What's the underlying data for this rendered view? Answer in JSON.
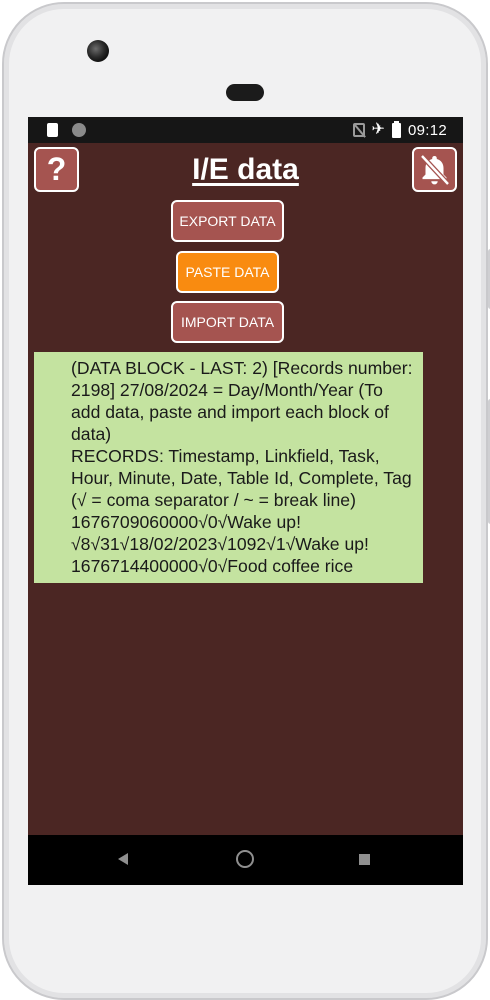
{
  "status_bar": {
    "time": "09:12",
    "icons": [
      "sd-card-icon",
      "sync-circle-icon",
      "no-sim-icon",
      "airplane-icon",
      "battery-icon"
    ]
  },
  "header": {
    "title": "I/E data",
    "help_label": "?",
    "help_icon": "question-mark-icon",
    "bell_icon": "bell-off-icon"
  },
  "actions": {
    "export_label": "EXPORT DATA",
    "paste_label": "PASTE DATA",
    "import_label": "IMPORT DATA"
  },
  "data_block": {
    "text": "(DATA BLOCK - LAST: 2) [Records number: 2198] 27/08/2024 = Day/Month/Year (To add data, paste and import each block of data)\nRECORDS: Timestamp, Linkfield, Task, Hour, Minute, Date, Table Id, Complete, Tag (√ = coma separator / ~ = break line)\n1676709060000√0√Wake up!√8√31√18/02/2023√1092√1√Wake up!\n1676714400000√0√Food coffee rice"
  },
  "nav_bar": {
    "icons": [
      "back-triangle-icon",
      "home-circle-icon",
      "recents-square-icon"
    ]
  },
  "colors": {
    "background": "#4b2623",
    "button": "#a55450",
    "paste_button": "#f98b10",
    "data_box": "#c4e3a0"
  }
}
